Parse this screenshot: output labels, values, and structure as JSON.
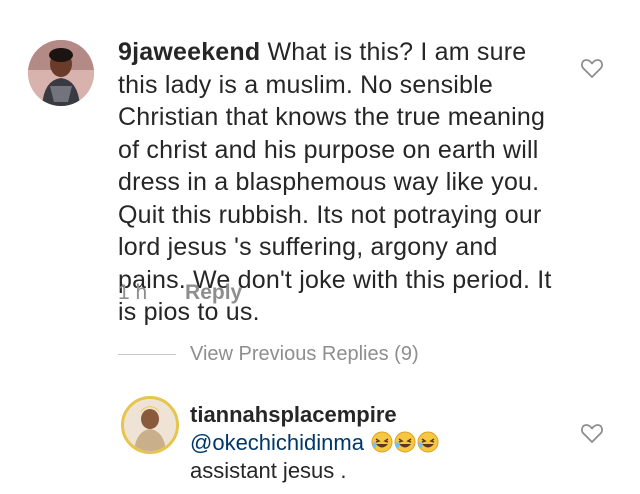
{
  "comment": {
    "username": "9jaweekend",
    "text": "What is this? I am sure this lady is a muslim. No sensible Christian that knows the true meaning of christ and his purpose on earth will dress in a blasphemous way like you. Quit this rubbish.  Its not potraying our lord jesus 's suffering, argony and pains. We don't joke with this period.  It is pios to us.",
    "time": "1 h",
    "reply_label": "Reply"
  },
  "view_previous_replies": "View Previous Replies (9)",
  "reply": {
    "username": "tiannahsplacempire",
    "mention": "@okechichidinma",
    "emojis": [
      "laughing-emoji",
      "laughing-emoji",
      "laughing-emoji"
    ],
    "text": "assistant jesus ."
  },
  "icons": {
    "like": "heart-outline-icon"
  },
  "colors": {
    "muted": "#8e8e8e",
    "mention": "#00376b",
    "avatar_ring": "#e7c44c"
  }
}
